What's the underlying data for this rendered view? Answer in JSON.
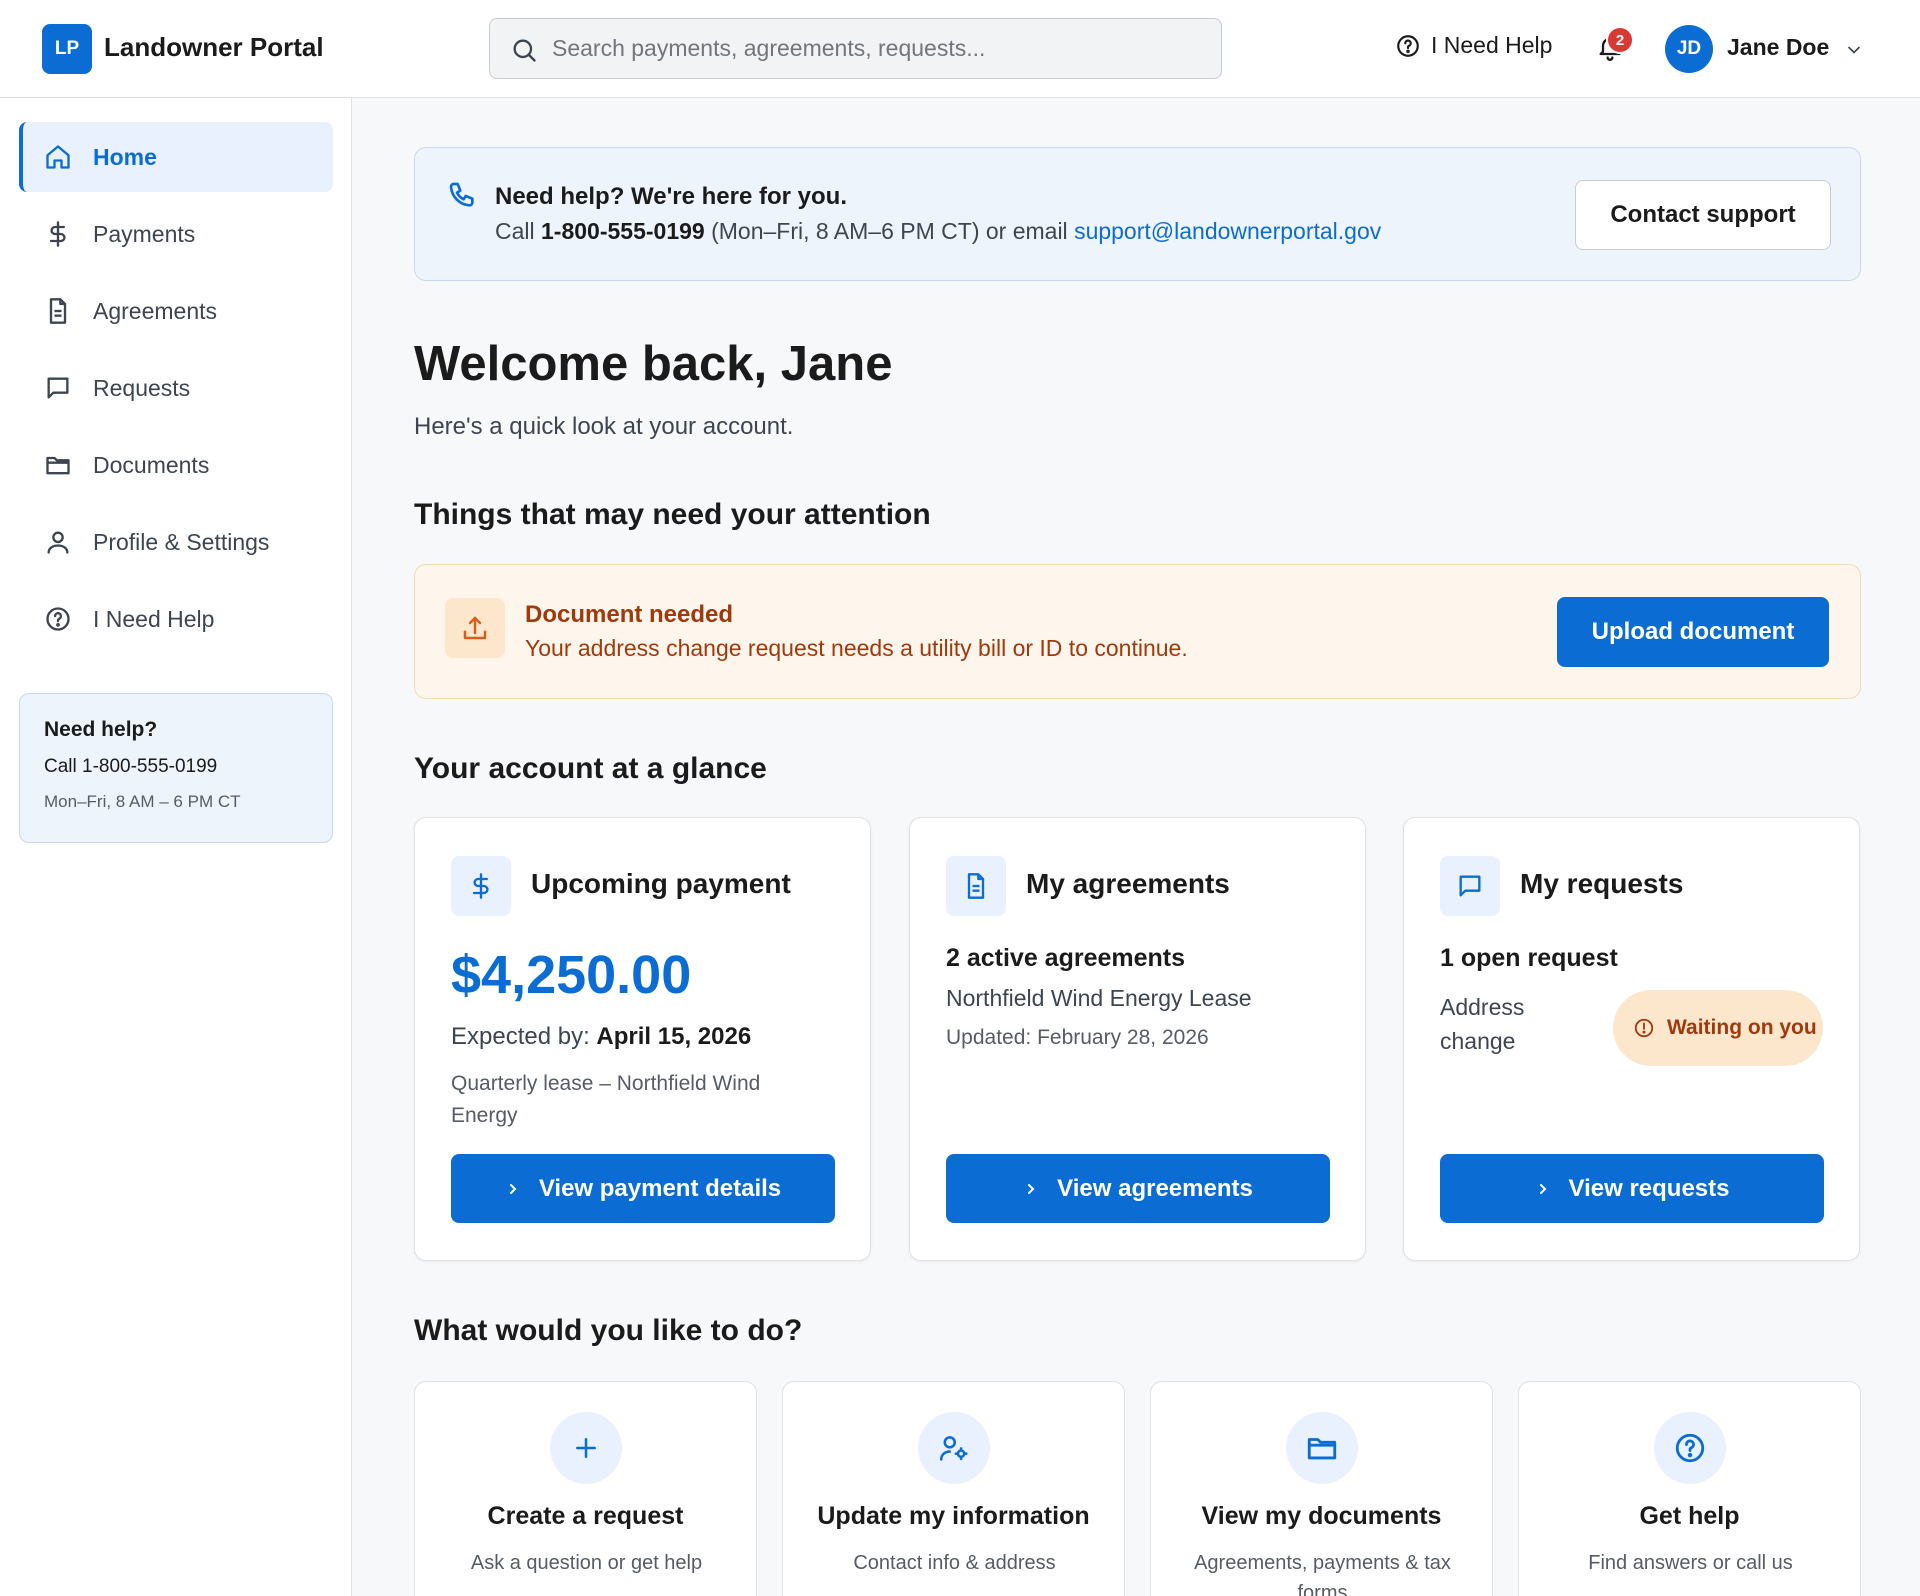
{
  "header": {
    "logo_initials": "LP",
    "app_title": "Landowner Portal",
    "search_placeholder": "Search payments, agreements, requests...",
    "help_label": "I Need Help",
    "notification_count": "2",
    "user_initials": "JD",
    "user_name": "Jane Doe"
  },
  "sidebar": {
    "items": [
      {
        "label": "Home",
        "icon": "home-icon",
        "active": true
      },
      {
        "label": "Payments",
        "icon": "dollar-icon"
      },
      {
        "label": "Agreements",
        "icon": "document-icon"
      },
      {
        "label": "Requests",
        "icon": "chat-icon"
      },
      {
        "label": "Documents",
        "icon": "folder-icon"
      },
      {
        "label": "Profile & Settings",
        "icon": "user-icon"
      },
      {
        "label": "I Need Help",
        "icon": "help-icon"
      }
    ],
    "help_box": {
      "title": "Need help?",
      "phone": "Call 1-800-555-0199",
      "hours": "Mon–Fri, 8 AM – 6 PM CT"
    }
  },
  "help_banner": {
    "title": "Need help? We're here for you.",
    "call_prefix": "Call ",
    "phone": "1-800-555-0199",
    "middle": " (Mon–Fri, 8 AM–6 PM CT) or email ",
    "email": "support@landownerportal.gov",
    "button": "Contact support"
  },
  "welcome": {
    "title": "Welcome back, Jane",
    "subtitle": "Here's a quick look at your account."
  },
  "attention": {
    "heading": "Things that may need your attention",
    "alert_title": "Document needed",
    "alert_text": "Your address change request needs a utility bill or ID to continue.",
    "alert_button": "Upload document"
  },
  "glance": {
    "heading": "Your account at a glance",
    "payment": {
      "title": "Upcoming payment",
      "amount": "$4,250.00",
      "expected_label": "Expected by: ",
      "expected_date": "April 15, 2026",
      "description": "Quarterly lease – Northfield Wind Energy",
      "button": "View payment details"
    },
    "agreements": {
      "title": "My agreements",
      "count": "2 active agreements",
      "name": "Northfield Wind Energy Lease",
      "updated": "Updated: February 28, 2026",
      "button": "View agreements"
    },
    "requests": {
      "title": "My requests",
      "count": "1 open request",
      "item": "Address change",
      "status": "Waiting on you",
      "button": "View requests"
    }
  },
  "actions": {
    "heading": "What would you like to do?",
    "items": [
      {
        "title": "Create a request",
        "desc": "Ask a question or get help",
        "icon": "plus-icon"
      },
      {
        "title": "Update my information",
        "desc": "Contact info & address",
        "icon": "user-settings-icon"
      },
      {
        "title": "View my documents",
        "desc": "Agreements, payments & tax forms",
        "icon": "folder-icon"
      },
      {
        "title": "Get help",
        "desc": "Find answers or call us",
        "icon": "help-icon"
      }
    ]
  },
  "colors": {
    "primary": "#0b6cd3",
    "warning_text": "#a0390c",
    "warning_bg": "#fef6ec",
    "notification": "#d83933"
  }
}
